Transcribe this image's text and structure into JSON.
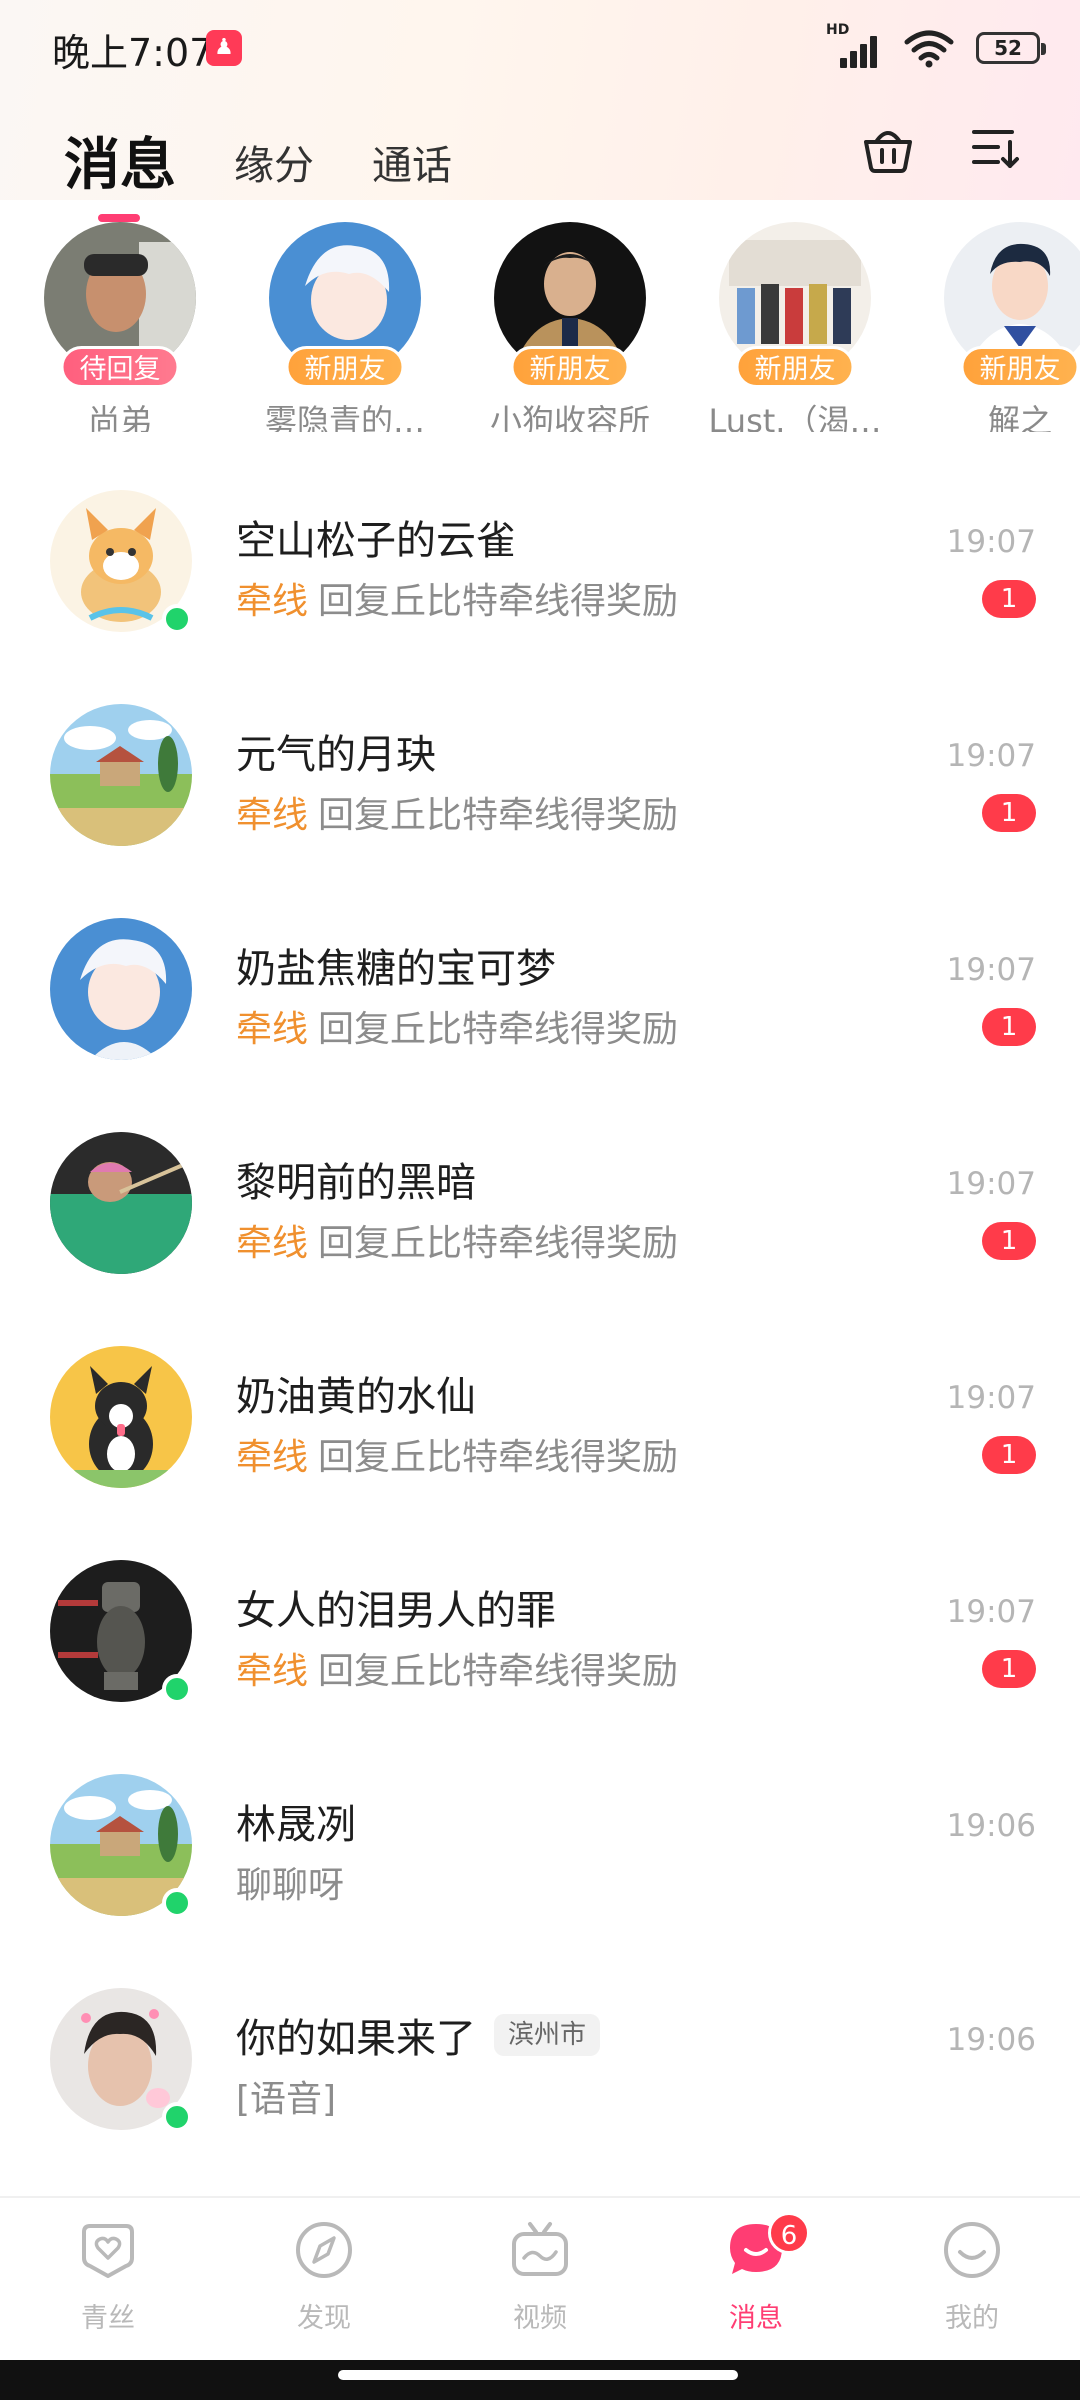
{
  "status_bar": {
    "time": "晚上7:07",
    "network": "HD",
    "battery": "52"
  },
  "header": {
    "tabs": [
      {
        "label": "消息",
        "active": true
      },
      {
        "label": "缘分",
        "active": false
      },
      {
        "label": "通话",
        "active": false
      }
    ],
    "icons": [
      "basket-icon",
      "sort-list-icon"
    ]
  },
  "stories": [
    {
      "name": "尚弟",
      "badge": "待回复",
      "badge_type": "reply"
    },
    {
      "name": "雾隐青的…",
      "badge": "新朋友",
      "badge_type": "new"
    },
    {
      "name": "小狗收容所",
      "badge": "新朋友",
      "badge_type": "new"
    },
    {
      "name": "Lust.（渴…",
      "badge": "新朋友",
      "badge_type": "new"
    },
    {
      "name": "解之",
      "badge": "新朋友",
      "badge_type": "new"
    }
  ],
  "messages": [
    {
      "name": "空山松子的云雀",
      "tag": "牵线",
      "preview": "回复丘比特牵线得奖励",
      "time": "19:07",
      "unread": "1",
      "online": true
    },
    {
      "name": "元气的月玦",
      "tag": "牵线",
      "preview": "回复丘比特牵线得奖励",
      "time": "19:07",
      "unread": "1",
      "online": false
    },
    {
      "name": "奶盐焦糖的宝可梦",
      "tag": "牵线",
      "preview": "回复丘比特牵线得奖励",
      "time": "19:07",
      "unread": "1",
      "online": false
    },
    {
      "name": "黎明前的黑暗",
      "tag": "牵线",
      "preview": "回复丘比特牵线得奖励",
      "time": "19:07",
      "unread": "1",
      "online": false
    },
    {
      "name": "奶油黄的水仙",
      "tag": "牵线",
      "preview": "回复丘比特牵线得奖励",
      "time": "19:07",
      "unread": "1",
      "online": false
    },
    {
      "name": "女人的泪男人的罪",
      "tag": "牵线",
      "preview": "回复丘比特牵线得奖励",
      "time": "19:07",
      "unread": "1",
      "online": true
    },
    {
      "name": "林晟冽",
      "tag": "",
      "preview": "聊聊呀",
      "time": "19:06",
      "unread": "",
      "online": true
    },
    {
      "name": "你的如果来了",
      "location": "滨州市",
      "tag": "",
      "preview": "[语音]",
      "time": "19:06",
      "unread": "",
      "online": true
    }
  ],
  "bottom_nav": [
    {
      "label": "青丝",
      "icon": "heart-shield-icon",
      "active": false
    },
    {
      "label": "发现",
      "icon": "compass-icon",
      "active": false
    },
    {
      "label": "视频",
      "icon": "tv-icon",
      "active": false
    },
    {
      "label": "消息",
      "icon": "chat-bubble-icon",
      "active": true,
      "badge": "6"
    },
    {
      "label": "我的",
      "icon": "smiley-icon",
      "active": false
    }
  ],
  "colors": {
    "accent": "#ff3d73",
    "tag_orange": "#f0902e",
    "online_green": "#20d36b",
    "unread_red": "#ff3b4a"
  }
}
